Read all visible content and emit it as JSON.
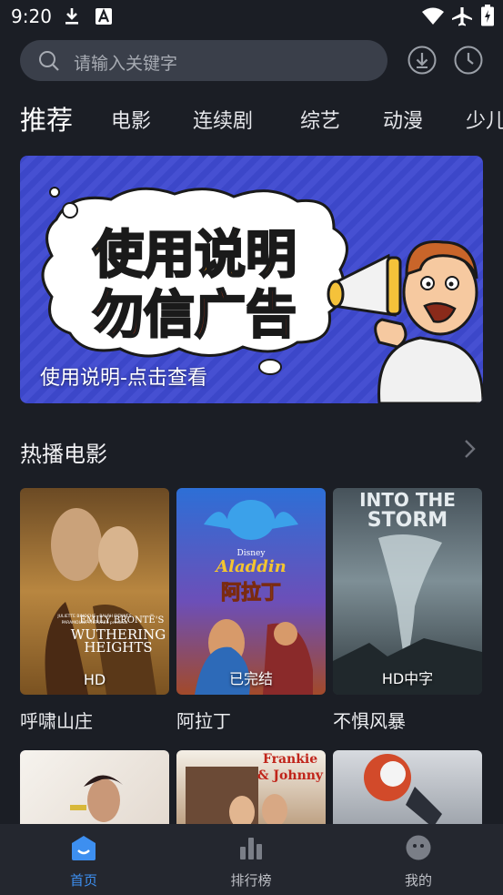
{
  "status_bar": {
    "time": "9:20"
  },
  "search": {
    "placeholder": "请输入关键字"
  },
  "tabs": [
    {
      "label": "推荐",
      "active": true
    },
    {
      "label": "电影"
    },
    {
      "label": "连续剧"
    },
    {
      "label": "综艺"
    },
    {
      "label": "动漫"
    },
    {
      "label": "少儿"
    }
  ],
  "banner": {
    "headline_1": "使用说明",
    "headline_2": "勿信广告",
    "caption": "使用说明-点击查看"
  },
  "section": {
    "title": "热播电影"
  },
  "movies": [
    {
      "title": "呼啸山庄",
      "badge": "HD",
      "poster_lines": [
        "EMILY BRONTË'S",
        "WUTHERING",
        "HEIGHTS"
      ],
      "poster_credits": "JULIETTE BINOCHE · RALPH FIENNES",
      "poster_studio": "PARAMOUNT PICTURES presents"
    },
    {
      "title": "阿拉丁",
      "badge": "已完结",
      "poster_brand": "Disney",
      "poster_script": "Aladdin",
      "poster_cn": "阿拉丁"
    },
    {
      "title": "不惧风暴",
      "badge": "HD中字",
      "poster_lines": [
        "INTO THE",
        "STORM"
      ]
    }
  ],
  "row2_posters": [
    {
      "text": ""
    },
    {
      "text_1": "Frankie",
      "text_2": "& Johnny"
    },
    {
      "text": ""
    }
  ],
  "bottom_nav": [
    {
      "label": "首页",
      "active": true
    },
    {
      "label": "排行榜"
    },
    {
      "label": "我的"
    }
  ],
  "colors": {
    "background": "#1b1e25",
    "search_bg": "#3a3f4a",
    "accent": "#3d8ff0",
    "banner_blue": "#4650d2",
    "banner_orange": "#f39a1c",
    "banner_red": "#e0401a"
  },
  "icons": {
    "status": [
      "download-icon",
      "font-a-icon",
      "wifi-icon",
      "airplane-icon",
      "battery-charging-icon"
    ],
    "top_actions": [
      "download-circle-icon",
      "history-clock-icon"
    ],
    "nav": [
      "home-icon",
      "chart-bar-icon",
      "profile-face-icon"
    ]
  }
}
